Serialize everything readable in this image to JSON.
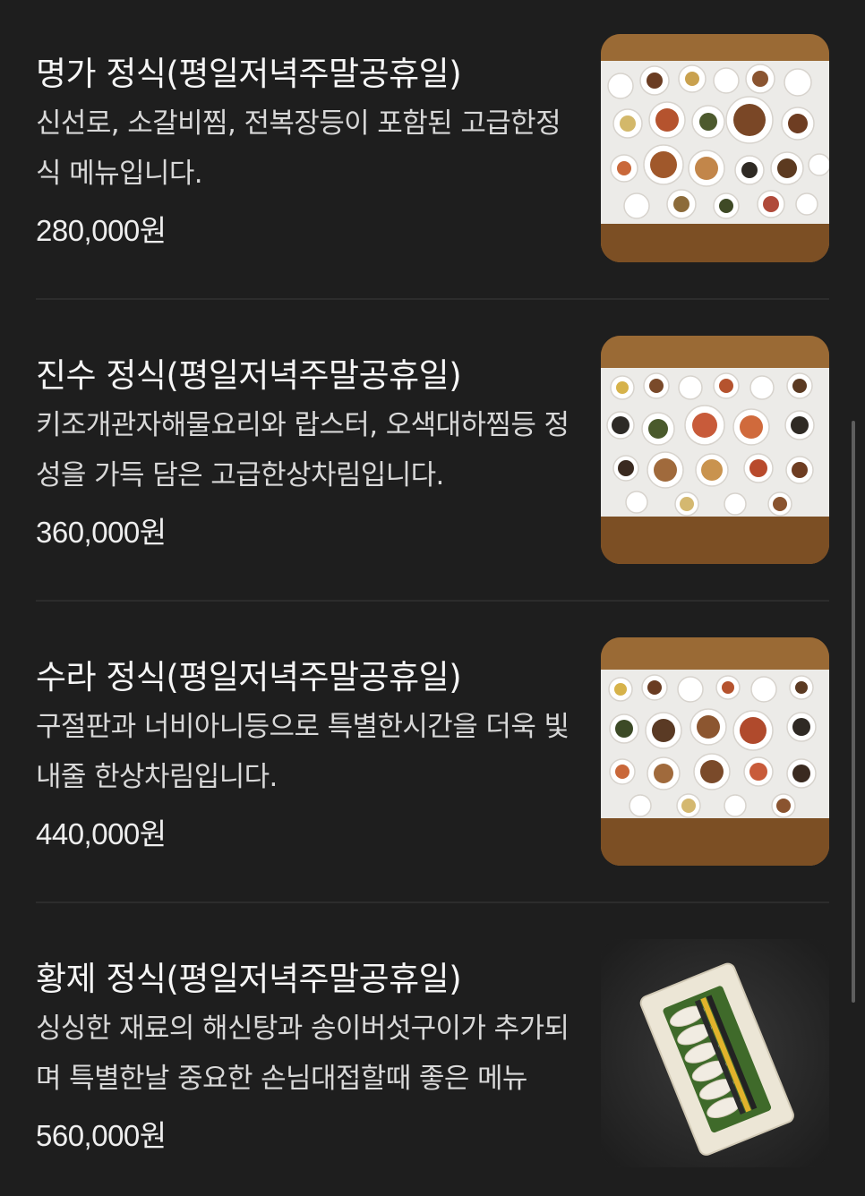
{
  "menu": {
    "items": [
      {
        "title": "명가 정식(평일저녁주말공휴일)",
        "description": "신선로, 소갈비찜, 전복장등이 포함된 고급한정식 메뉴입니다.",
        "price": "280,000원",
        "image_icon": "hanjeongsik-table-photo"
      },
      {
        "title": "진수 정식(평일저녁주말공휴일)",
        "description": "키조개관자해물요리와 랍스터, 오색대하찜등 정성을 가득 담은 고급한상차림입니다.",
        "price": "360,000원",
        "image_icon": "hanjeongsik-table-photo"
      },
      {
        "title": "수라 정식(평일저녁주말공휴일)",
        "description": "구절판과 너비아니등으로 특별한시간을 더욱 빛내줄 한상차림입니다.",
        "price": "440,000원",
        "image_icon": "hanjeongsik-table-photo"
      },
      {
        "title": "황제 정식(평일저녁주말공휴일)",
        "description": "싱싱한 재료의 해신탕과 송이버섯구이가 추가되며 특별한날 중요한 손님대접할때 좋은 메뉴",
        "price": "560,000원",
        "image_icon": "fish-platter-photo"
      }
    ]
  },
  "colors": {
    "background": "#1e1e1e",
    "text_primary": "#f6f6f6",
    "text_secondary": "#d8d8d8",
    "divider": "#2c2c2c"
  }
}
